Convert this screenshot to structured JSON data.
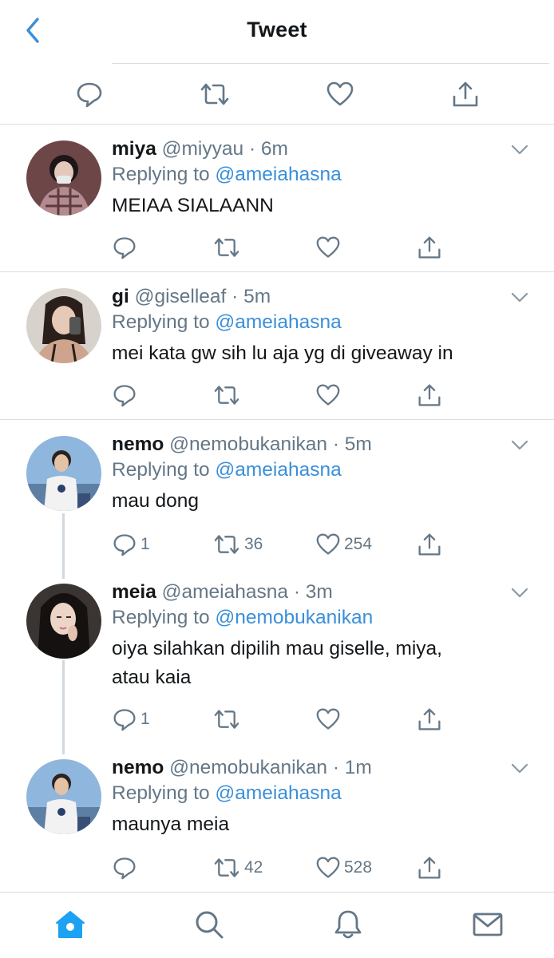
{
  "header": {
    "title": "Tweet",
    "back_icon": "chevron-left-icon",
    "accent": "#1da1f2"
  },
  "main_actions": [
    "reply-icon",
    "retweet-icon",
    "like-icon",
    "share-icon"
  ],
  "replies": [
    {
      "name": "miya",
      "handle": "@miyyau",
      "time": "6m",
      "replying_prefix": "Replying to",
      "replying_to": "@ameiahasna",
      "text": "MEIAA SIALAANN",
      "reply_count": "",
      "retweet_count": "",
      "like_count": ""
    },
    {
      "name": "gi",
      "handle": "@giselleaf",
      "time": "5m",
      "replying_prefix": "Replying to",
      "replying_to": "@ameiahasna",
      "text": "mei kata gw sih lu aja yg di giveaway in",
      "reply_count": "",
      "retweet_count": "",
      "like_count": ""
    },
    {
      "name": "nemo",
      "handle": "@nemobukanikan",
      "time": "5m",
      "replying_prefix": "Replying to",
      "replying_to": "@ameiahasna",
      "text": "mau dong",
      "reply_count": "1",
      "retweet_count": "36",
      "like_count": "254"
    },
    {
      "name": "meia",
      "handle": "@ameiahasna",
      "time": "3m",
      "replying_prefix": "Replying to",
      "replying_to": "@nemobukanikan",
      "text": "oiya silahkan dipilih mau giselle, miya, atau kaia",
      "reply_count": "1",
      "retweet_count": "",
      "like_count": ""
    },
    {
      "name": "nemo",
      "handle": "@nemobukanikan",
      "time": "1m",
      "replying_prefix": "Replying to",
      "replying_to": "@ameiahasna",
      "text": "maunya meia",
      "reply_count": "",
      "retweet_count": "42",
      "like_count": "528"
    }
  ],
  "tabbar": [
    "home-icon",
    "search-icon",
    "notifications-icon",
    "messages-icon"
  ],
  "colors": {
    "link": "#3a8fd9",
    "secondary": "#657786",
    "divider": "#d9dee2",
    "home_active": "#1da1f2"
  }
}
